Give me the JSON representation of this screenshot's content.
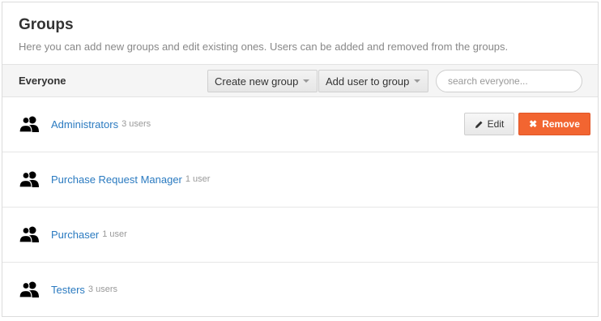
{
  "header": {
    "title": "Groups",
    "subtitle": "Here you can add new groups and edit existing ones. Users can be added and removed from the groups."
  },
  "toolbar": {
    "label": "Everyone",
    "create_group_label": "Create new group",
    "add_user_label": "Add user to group",
    "search_placeholder": "search everyone..."
  },
  "groups": [
    {
      "name": "Administrators",
      "count": "3 users",
      "icon": "group-icon"
    },
    {
      "name": "Purchase Request Manager",
      "count": "1 user",
      "icon": "group-icon"
    },
    {
      "name": "Purchaser",
      "count": "1 user",
      "icon": "group-icon"
    },
    {
      "name": "Testers",
      "count": "3 users",
      "icon": "group-icon"
    }
  ],
  "actions": {
    "edit_label": "Edit",
    "remove_label": "Remove"
  },
  "colors": {
    "link": "#2a7ac0",
    "remove": "#f26531"
  }
}
